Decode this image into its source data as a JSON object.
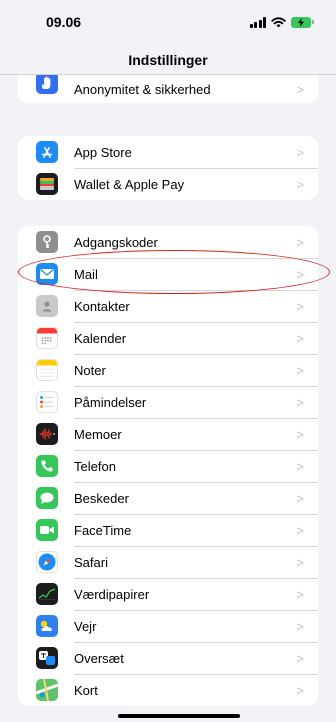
{
  "status_bar": {
    "time": "09.06"
  },
  "nav": {
    "title": "Indstillinger"
  },
  "groups": [
    {
      "items": [
        {
          "label": "Anonymitet & sikkerhed",
          "icon": "privacy-hand-icon",
          "color": "#2f6ef5"
        }
      ]
    },
    {
      "items": [
        {
          "label": "App Store",
          "icon": "app-store-icon",
          "color": "#1d8cf8"
        },
        {
          "label": "Wallet & Apple Pay",
          "icon": "wallet-icon",
          "color": "#1c1c1e"
        }
      ]
    },
    {
      "items": [
        {
          "label": "Adgangskoder",
          "icon": "key-icon",
          "color": "#8e8e93"
        },
        {
          "label": "Mail",
          "icon": "mail-icon",
          "color": "#1a8cf5"
        },
        {
          "label": "Kontakter",
          "icon": "contacts-icon",
          "color": "#c9c9cc"
        },
        {
          "label": "Kalender",
          "icon": "calendar-icon",
          "color": "#ffffff"
        },
        {
          "label": "Noter",
          "icon": "notes-icon",
          "color": "#ffffff"
        },
        {
          "label": "Påmindelser",
          "icon": "reminders-icon",
          "color": "#ffffff"
        },
        {
          "label": "Memoer",
          "icon": "voice-memos-icon",
          "color": "#1c1c1e"
        },
        {
          "label": "Telefon",
          "icon": "phone-icon",
          "color": "#34c759"
        },
        {
          "label": "Beskeder",
          "icon": "messages-icon",
          "color": "#34c759"
        },
        {
          "label": "FaceTime",
          "icon": "facetime-icon",
          "color": "#34c759"
        },
        {
          "label": "Safari",
          "icon": "safari-icon",
          "color": "#1a8cf5"
        },
        {
          "label": "Værdipapirer",
          "icon": "stocks-icon",
          "color": "#1c1c1e"
        },
        {
          "label": "Vejr",
          "icon": "weather-icon",
          "color": "#2f7ff0"
        },
        {
          "label": "Oversæt",
          "icon": "translate-icon",
          "color": "#1c1c1e"
        },
        {
          "label": "Kort",
          "icon": "maps-icon",
          "color": "#5cc36b"
        }
      ]
    }
  ],
  "chevron": ">",
  "annotation": {
    "color": "#d5231c",
    "target": "Mail"
  }
}
